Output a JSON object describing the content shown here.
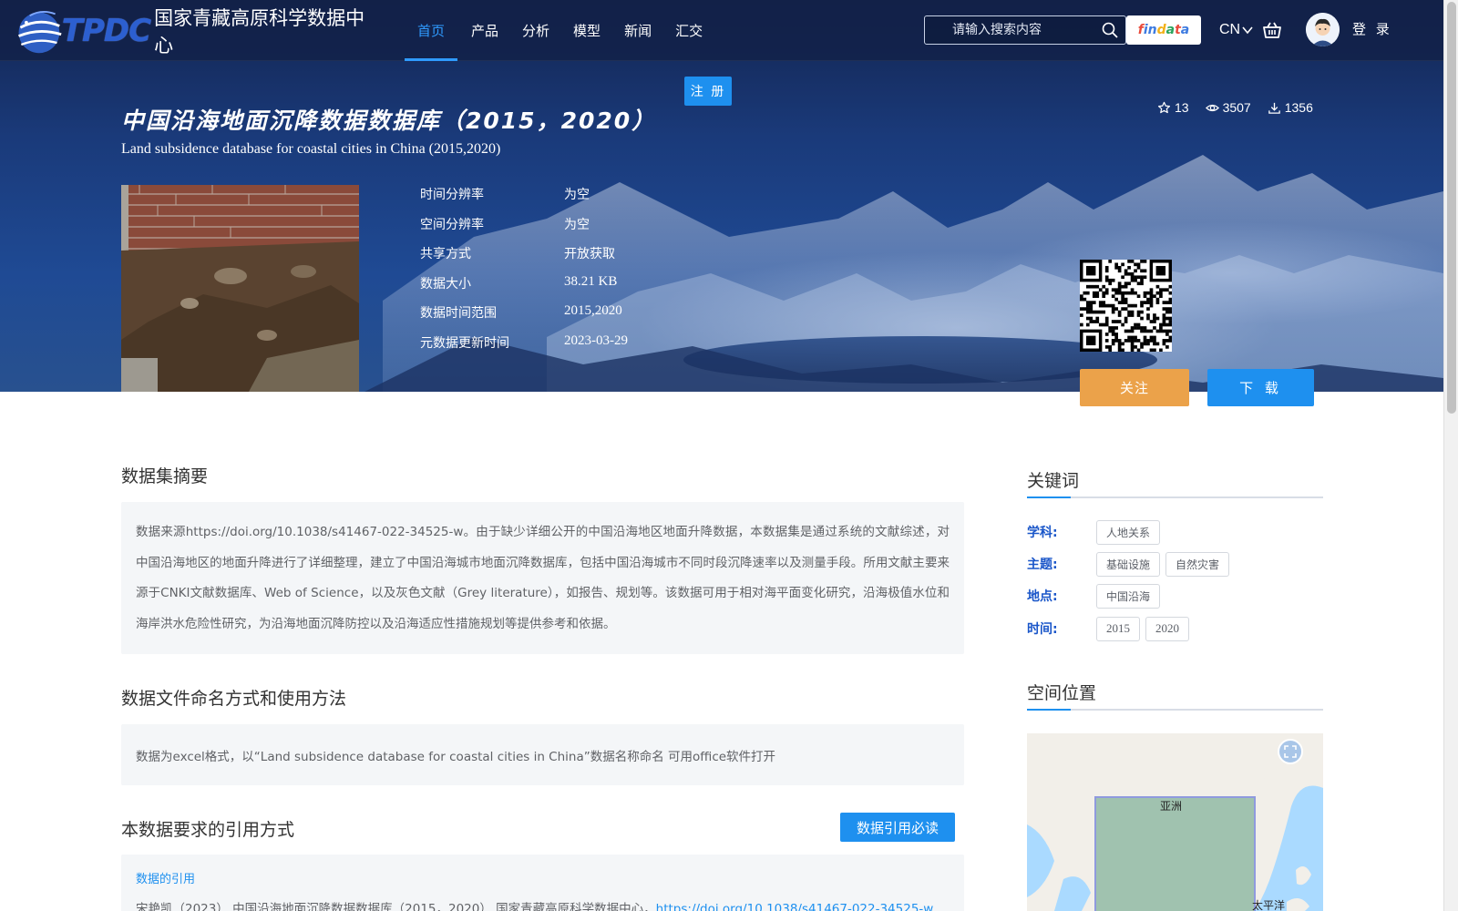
{
  "header": {
    "logo_abbr": "TPDC",
    "logo_name": "国家青藏高原科学数据中心",
    "nav": [
      {
        "label": "首页",
        "active": true
      },
      {
        "label": "产品"
      },
      {
        "label": "分析"
      },
      {
        "label": "模型"
      },
      {
        "label": "新闻"
      },
      {
        "label": "汇交"
      }
    ],
    "search_placeholder": "请输入搜索内容",
    "search_icon": "search-icon",
    "findata_brand": "findata",
    "language": "CN",
    "cart_icon": "basket-icon",
    "login_label": "登 录",
    "register_label": "注 册"
  },
  "dataset": {
    "title_cn": "中国沿海地面沉降数据数据库（2015，2020）",
    "title_en": "Land subsidence database for coastal cities in China (2015,2020)",
    "stats": {
      "stars": "13",
      "views": "3507",
      "downloads": "1356"
    },
    "meta": [
      {
        "label": "时间分辨率",
        "value": "为空"
      },
      {
        "label": "空间分辨率",
        "value": "为空"
      },
      {
        "label": "共享方式",
        "value": "开放获取"
      },
      {
        "label": "数据大小",
        "value": "38.21 KB"
      },
      {
        "label": "数据时间范围",
        "value": "2015,2020"
      },
      {
        "label": "元数据更新时间",
        "value": "2023-03-29"
      }
    ],
    "follow_label": "关注",
    "download_label": "下 载"
  },
  "content": {
    "abstract_title": "数据集摘要",
    "abstract_text": "数据来源https://doi.org/10.1038/s41467-022-34525-w。由于缺少详细公开的中国沿海地区地面升降数据，本数据集是通过系统的文献综述，对中国沿海地区的地面升降进行了详细整理，建立了中国沿海城市地面沉降数据库，包括中国沿海城市不同时段沉降速率以及测量手段。所用文献主要来源于CNKI文献数据库、Web of Science，以及灰色文献（Grey literature），如报告、规划等。该数据可用于相对海平面变化研究，沿海极值水位和海岸洪水危险性研究，为沿海地面沉降防控以及沿海适应性措施规划等提供参考和依据。",
    "naming_title": "数据文件命名方式和使用方法",
    "naming_text": "数据为excel格式，以“Land subsidence database for coastal cities in China”数据名称命名 可用office软件打开",
    "citation_title": "本数据要求的引用方式",
    "citation_button": "数据引用必读",
    "citation_label": "数据的引用",
    "citation_text": "宋艳凯（2023）.中国沿海地面沉降数据数据库（2015，2020）.国家青藏高原科学数据中心，",
    "citation_link": "https://doi.org/10.1038/s41467-022-34525-w"
  },
  "sidebar": {
    "keywords_title": "关键词",
    "keywords": [
      {
        "label": "学科:",
        "tags": [
          "人地关系"
        ]
      },
      {
        "label": "主题:",
        "tags": [
          "基础设施",
          "自然灾害"
        ]
      },
      {
        "label": "地点:",
        "tags": [
          "中国沿海"
        ]
      },
      {
        "label": "时间:",
        "tags": [
          "2015",
          "2020"
        ]
      }
    ],
    "location_title": "空间位置",
    "map_labels": {
      "asia": "亚洲",
      "pacific": "太平洋"
    },
    "fullscreen_icon": "fullscreen-icon"
  },
  "colors": {
    "accent": "#1e90ef",
    "follow": "#eba24a",
    "keyword_label": "#1a56c9",
    "nav_active": "#2f9bff"
  }
}
